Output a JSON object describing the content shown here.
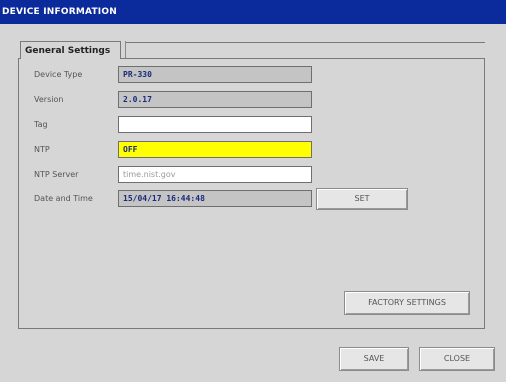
{
  "window": {
    "title": "DEVICE INFORMATION"
  },
  "tab": {
    "label": "General Settings"
  },
  "fields": {
    "device_type": {
      "label": "Device Type",
      "value": "PR-330"
    },
    "version": {
      "label": "Version",
      "value": "2.0.17"
    },
    "tag": {
      "label": "Tag",
      "value": ""
    },
    "ntp": {
      "label": "NTP",
      "value": "OFF"
    },
    "ntp_server": {
      "label": "NTP Server",
      "value": "time.nist.gov"
    },
    "date_time": {
      "label": "Date and Time",
      "value": "15/04/17 16:44:48"
    }
  },
  "buttons": {
    "set": "SET",
    "factory": "FACTORY SETTINGS",
    "save": "SAVE",
    "close": "CLOSE"
  },
  "colors": {
    "titlebar": "#0b2a9c",
    "ntp_highlight": "#ffff00"
  }
}
